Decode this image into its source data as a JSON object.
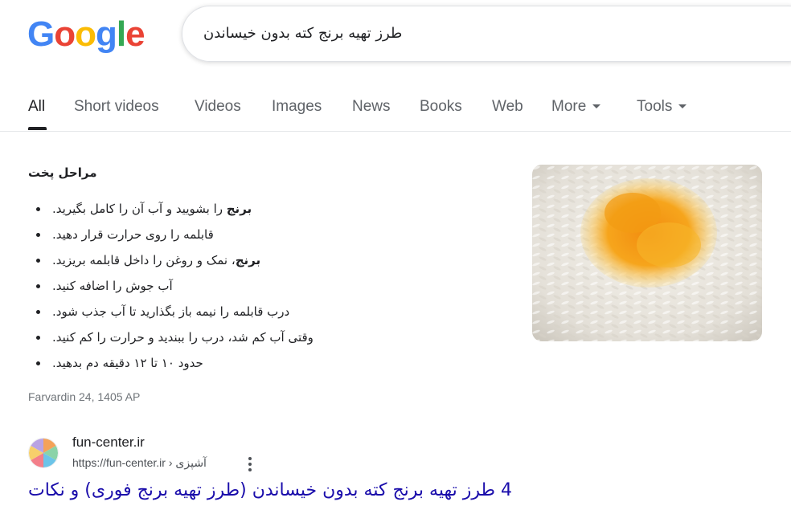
{
  "logo": {
    "letters": [
      "G",
      "o",
      "o",
      "g",
      "l",
      "e"
    ],
    "colors": [
      "#4285F4",
      "#EA4335",
      "#FBBC05",
      "#4285F4",
      "#34A853",
      "#EA4335"
    ]
  },
  "search": {
    "query": "طرز تهیه برنج کته بدون خیساندن"
  },
  "tabs": [
    {
      "label": "All",
      "active": true
    },
    {
      "label": "Short videos"
    },
    {
      "label": "Videos"
    },
    {
      "label": "Images"
    },
    {
      "label": "News"
    },
    {
      "label": "Books"
    },
    {
      "label": "Web"
    },
    {
      "label": "More"
    },
    {
      "label": "Tools"
    }
  ],
  "snippet": {
    "title": "مراحل پخت",
    "steps": [
      {
        "bold": "برنج",
        "text": " را بشویید و آب آن را کامل بگیرید."
      },
      {
        "bold": "",
        "text": "قابلمه را روی حرارت قرار دهید."
      },
      {
        "bold": "برنج",
        "text": "، نمک و روغن را داخل قابلمه بریزید."
      },
      {
        "bold": "",
        "text": "آب جوش را اضافه کنید."
      },
      {
        "bold": "",
        "text": "درب قابلمه را نیمه باز بگذارید تا آب جذب شود."
      },
      {
        "bold": "",
        "text": "وقتی آب کم شد، درب را ببندید و حرارت را کم کنید."
      },
      {
        "bold": "",
        "text": "حدود ۱۰ تا ۱۲ دقیقه دم بدهید."
      }
    ],
    "date": "Farvardin 24, 1405 AP"
  },
  "result": {
    "site_name": "fun-center.ir",
    "url": "https://fun-center.ir",
    "breadcrumb": "آشپزی",
    "separator": "›",
    "title": "4 طرز تهیه برنج کته بدون خیساندن (طرز تهیه برنج فوری) و نکات"
  }
}
